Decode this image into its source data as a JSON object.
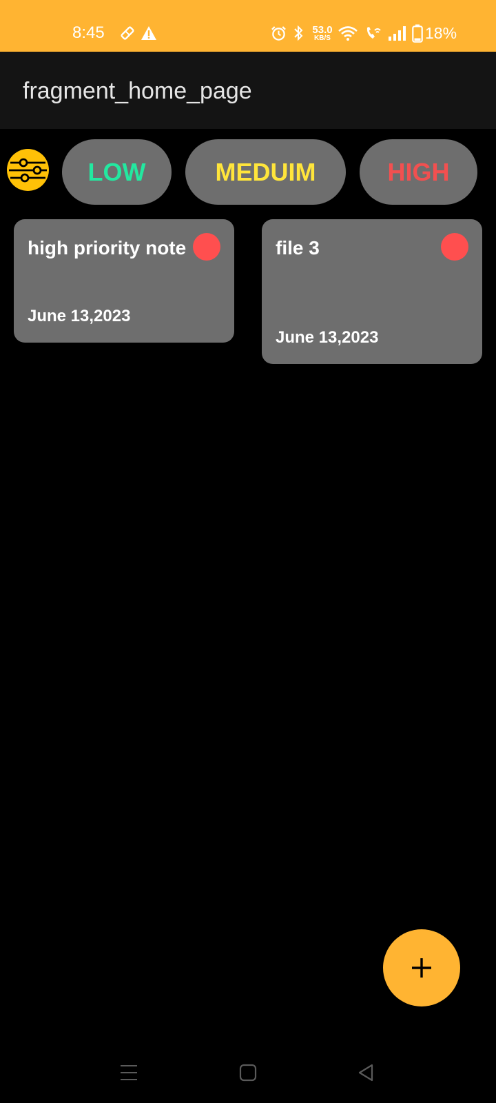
{
  "status_bar": {
    "time": "8:45",
    "net_speed_value": "53.0",
    "net_speed_unit": "KB/S",
    "battery_percent": "18%",
    "background_color": "#FFB432",
    "icons": [
      "notification-icon",
      "warning-icon",
      "alarm-icon",
      "bluetooth-icon",
      "wifi-icon",
      "wifi-calling-icon",
      "signal-icon",
      "battery-icon"
    ]
  },
  "app_bar": {
    "title": "fragment_home_page"
  },
  "filters": {
    "icon": "filter-sliders-icon",
    "chips": [
      {
        "label": "LOW",
        "color": "#23E8A0"
      },
      {
        "label": "MEDUIM",
        "color": "#FFE53B"
      },
      {
        "label": "HIGH",
        "color": "#F25050"
      }
    ]
  },
  "notes": [
    {
      "title": "high priority note",
      "date": "June 13,2023",
      "priority_color": "#FF4F4F"
    },
    {
      "title": "file 3",
      "date": "June 13,2023",
      "priority_color": "#FF4F4F"
    }
  ],
  "fab": {
    "icon": "plus-icon",
    "color": "#FFB432"
  },
  "nav_bar": {
    "buttons": [
      "menu-icon",
      "home-icon",
      "back-icon"
    ]
  }
}
